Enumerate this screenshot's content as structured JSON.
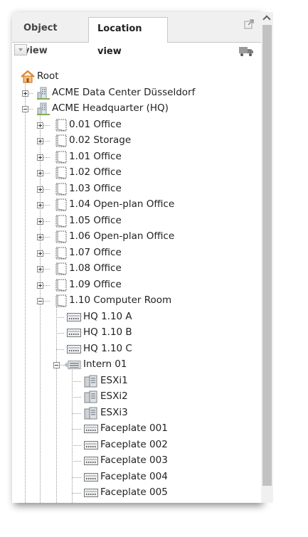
{
  "tabs": {
    "object_view": "Object view",
    "location_view": "Location view",
    "active": "location_view"
  },
  "tree": [
    {
      "label": "Root",
      "icon": "home-icon",
      "depth": 0,
      "toggle": null
    },
    {
      "label": "ACME Data Center Düsseldorf",
      "icon": "building-icon",
      "depth": 1,
      "toggle": "plus"
    },
    {
      "label": "ACME Headquarter (HQ)",
      "icon": "building-icon",
      "depth": 1,
      "toggle": "minus"
    },
    {
      "label": "0.01 Office",
      "icon": "room-icon",
      "depth": 2,
      "toggle": "plus"
    },
    {
      "label": "0.02 Storage",
      "icon": "room-icon",
      "depth": 2,
      "toggle": "plus"
    },
    {
      "label": "1.01 Office",
      "icon": "room-icon",
      "depth": 2,
      "toggle": "plus"
    },
    {
      "label": "1.02 Office",
      "icon": "room-icon",
      "depth": 2,
      "toggle": "plus"
    },
    {
      "label": "1.03 Office",
      "icon": "room-icon",
      "depth": 2,
      "toggle": "plus"
    },
    {
      "label": "1.04 Open-plan Office",
      "icon": "room-icon",
      "depth": 2,
      "toggle": "plus"
    },
    {
      "label": "1.05 Office",
      "icon": "room-icon",
      "depth": 2,
      "toggle": "plus"
    },
    {
      "label": "1.06 Open-plan Office",
      "icon": "room-icon",
      "depth": 2,
      "toggle": "plus"
    },
    {
      "label": "1.07 Office",
      "icon": "room-icon",
      "depth": 2,
      "toggle": "plus"
    },
    {
      "label": "1.08 Office",
      "icon": "room-icon",
      "depth": 2,
      "toggle": "plus"
    },
    {
      "label": "1.09 Office",
      "icon": "room-icon",
      "depth": 2,
      "toggle": "plus"
    },
    {
      "label": "1.10 Computer Room",
      "icon": "room-icon",
      "depth": 2,
      "toggle": "minus"
    },
    {
      "label": "HQ 1.10 A",
      "icon": "rack-icon",
      "depth": 3,
      "toggle": null
    },
    {
      "label": "HQ 1.10 B",
      "icon": "rack-icon",
      "depth": 3,
      "toggle": null
    },
    {
      "label": "HQ 1.10 C",
      "icon": "rack-icon",
      "depth": 3,
      "toggle": null
    },
    {
      "label": "Intern 01",
      "icon": "switch-icon",
      "depth": 3,
      "toggle": "minus"
    },
    {
      "label": "ESXi1",
      "icon": "server-icon",
      "depth": 4,
      "toggle": null
    },
    {
      "label": "ESXi2",
      "icon": "server-icon",
      "depth": 4,
      "toggle": null
    },
    {
      "label": "ESXi3",
      "icon": "server-icon",
      "depth": 4,
      "toggle": null
    },
    {
      "label": "Faceplate 001",
      "icon": "faceplate-icon",
      "depth": 4,
      "toggle": null
    },
    {
      "label": "Faceplate 002",
      "icon": "faceplate-icon",
      "depth": 4,
      "toggle": null
    },
    {
      "label": "Faceplate 003",
      "icon": "faceplate-icon",
      "depth": 4,
      "toggle": null
    },
    {
      "label": "Faceplate 004",
      "icon": "faceplate-icon",
      "depth": 4,
      "toggle": null
    },
    {
      "label": "Faceplate 005",
      "icon": "faceplate-icon",
      "depth": 4,
      "toggle": null
    }
  ],
  "colors": {
    "tab_bar": "#f0f0f0",
    "home_roof": "#e8882a",
    "scrollbar_thumb": "#c2c2c2"
  }
}
